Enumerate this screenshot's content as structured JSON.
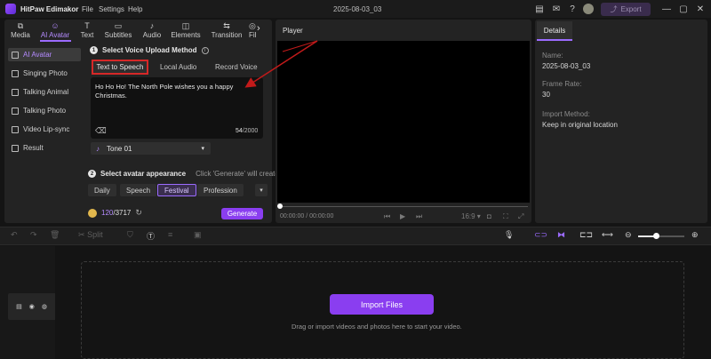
{
  "app": {
    "name": "HitPaw Edimakor",
    "project_title": "2025-08-03_03"
  },
  "menu": [
    "File",
    "Settings",
    "Help"
  ],
  "titlebar": {
    "export_label": "Export"
  },
  "tool_tabs": [
    {
      "label": "Media",
      "icon": "media-icon"
    },
    {
      "label": "AI Avatar",
      "icon": "avatar-icon"
    },
    {
      "label": "Text",
      "icon": "text-icon"
    },
    {
      "label": "Subtitles",
      "icon": "subtitles-icon"
    },
    {
      "label": "Audio",
      "icon": "audio-icon"
    },
    {
      "label": "Elements",
      "icon": "elements-icon"
    },
    {
      "label": "Transition",
      "icon": "transition-icon"
    },
    {
      "label": "Fil",
      "icon": "filter-icon"
    }
  ],
  "sidebar": {
    "items": [
      "AI Avatar",
      "Singing Photo",
      "Talking Animal",
      "Talking Photo",
      "Video Lip-sync",
      "Result"
    ]
  },
  "voice": {
    "step_number": "1",
    "step_title": "Select Voice Upload Method",
    "tabs": [
      "Text to Speech",
      "Local Audio",
      "Record Voice"
    ],
    "text": "Ho Ho Ho! The North Pole wishes you a happy Christmas.",
    "char_count": "54",
    "char_limit": "/2000",
    "tone": "Tone 01"
  },
  "avatar": {
    "step_number": "2",
    "step_title": "Select avatar appearance",
    "hint": "Click 'Generate' will create A",
    "chips": [
      "Daily",
      "Speech",
      "Festival",
      "Profession"
    ]
  },
  "credits": {
    "used": "120",
    "total": "/3717"
  },
  "generate_label": "Generate",
  "player": {
    "title": "Player",
    "time": "00:00:00 / 00:00:00",
    "ratio": "16:9"
  },
  "details": {
    "tab": "Details",
    "fields": [
      {
        "label": "Name:",
        "value": "2025-08-03_03"
      },
      {
        "label": "Frame Rate:",
        "value": "30"
      },
      {
        "label": "Import Method:",
        "value": "Keep in original location"
      }
    ]
  },
  "timeline": {
    "split_label": "Split",
    "import_label": "Import Files",
    "drop_hint": "Drag or import videos and photos here to start your video.",
    "zoom_level": 0.38
  },
  "colors": {
    "accent": "#8a3ef0",
    "highlight_box": "#d62828",
    "arrow": "#c21a1a"
  }
}
